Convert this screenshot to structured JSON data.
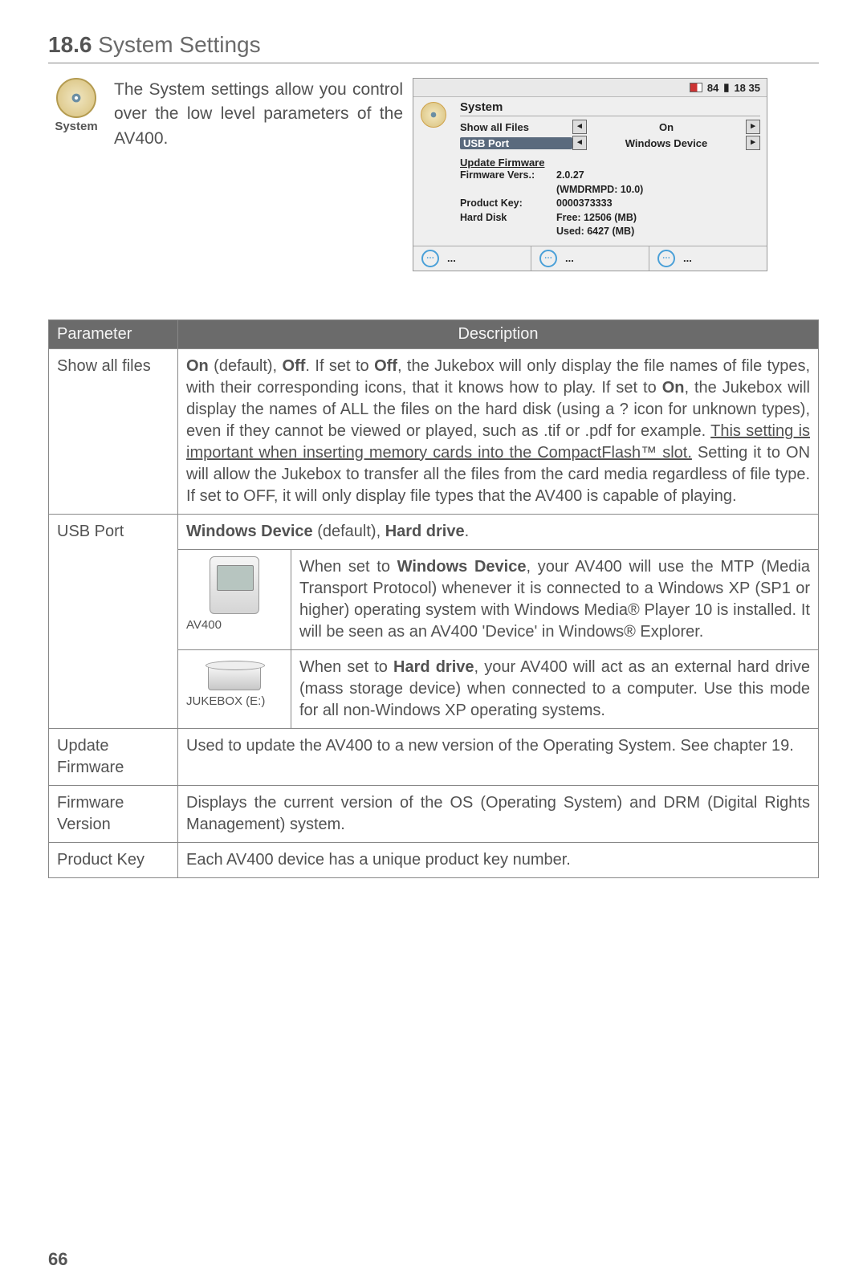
{
  "section": {
    "number": "18.6",
    "title": "System Settings"
  },
  "icon": {
    "label": "System"
  },
  "intro": "The System settings allow you control over the low level parameters of the AV400.",
  "device": {
    "battery": "84",
    "time": "18 35",
    "title": "System",
    "rows": [
      {
        "label": "Show all Files",
        "value": "On"
      },
      {
        "label": "USB Port",
        "value": "Windows Device"
      }
    ],
    "update_link": "Update Firmware",
    "info": {
      "fw_label": "Firmware Vers.:",
      "fw_val": "2.0.27",
      "drm": "(WMDRMPD: 10.0)",
      "pk_label": "Product Key:",
      "pk_val": "0000373333",
      "hd_label": "Hard Disk",
      "hd_free": "Free: 12506 (MB)",
      "hd_used": "Used: 6427 (MB)"
    },
    "footer_label": "..."
  },
  "table": {
    "headers": {
      "param": "Parameter",
      "desc": "Description"
    },
    "rows": {
      "show_all": {
        "param": "Show all files",
        "d": {
          "p1a": "On",
          "p1b": " (default), ",
          "p1c": "Off",
          "p1d": ". If set to ",
          "p1e": "Off",
          "p1f": ", the Jukebox will only display the file names of file types, with their corresponding icons, that it knows how to play. If set to ",
          "p1g": "On",
          "p1h": ", the Jukebox will display the names of ALL the files on the hard disk (using a ? icon for unknown types), even if they cannot be viewed or played, such as .tif or .pdf for example. ",
          "p1i": "This setting is important when inserting memory cards into the CompactFlash™ slot.",
          "p1j": " Setting it to ON will allow the Jukebox to transfer all the files from the card media regardless of file type. If set to OFF, it will only display file types that the AV400 is capable of playing."
        }
      },
      "usb": {
        "param": "USB Port",
        "header": {
          "a": "Windows Device",
          "b": " (default), ",
          "c": "Hard drive",
          "d": "."
        },
        "win": {
          "icon": "AV400",
          "t1": "When set to ",
          "t2": "Windows Device",
          "t3": ", your AV400 will use the MTP (Media Transport Protocol) whenever it is connected to a Windows XP (SP1 or higher) operating system with Windows Media® Player 10 is installed. It will be seen as an AV400 'Device' in Windows® Explorer."
        },
        "hd": {
          "icon": "JUKEBOX (E:)",
          "t1": "When set to ",
          "t2": "Hard drive",
          "t3": ", your AV400 will act as an external hard drive (mass storage device) when connected to a computer. Use this mode for all non-Windows XP operating systems."
        }
      },
      "update": {
        "param": "Update Firmware",
        "desc": "Used to update the AV400 to a new version of the Operating System. See chapter 19."
      },
      "fw": {
        "param": "Firmware Version",
        "desc": "Displays the current version of the OS (Operating System) and DRM (Digital Rights Management) system."
      },
      "pk": {
        "param": "Product Key",
        "desc": "Each AV400 device has a unique product key number."
      }
    }
  },
  "page_number": "66"
}
